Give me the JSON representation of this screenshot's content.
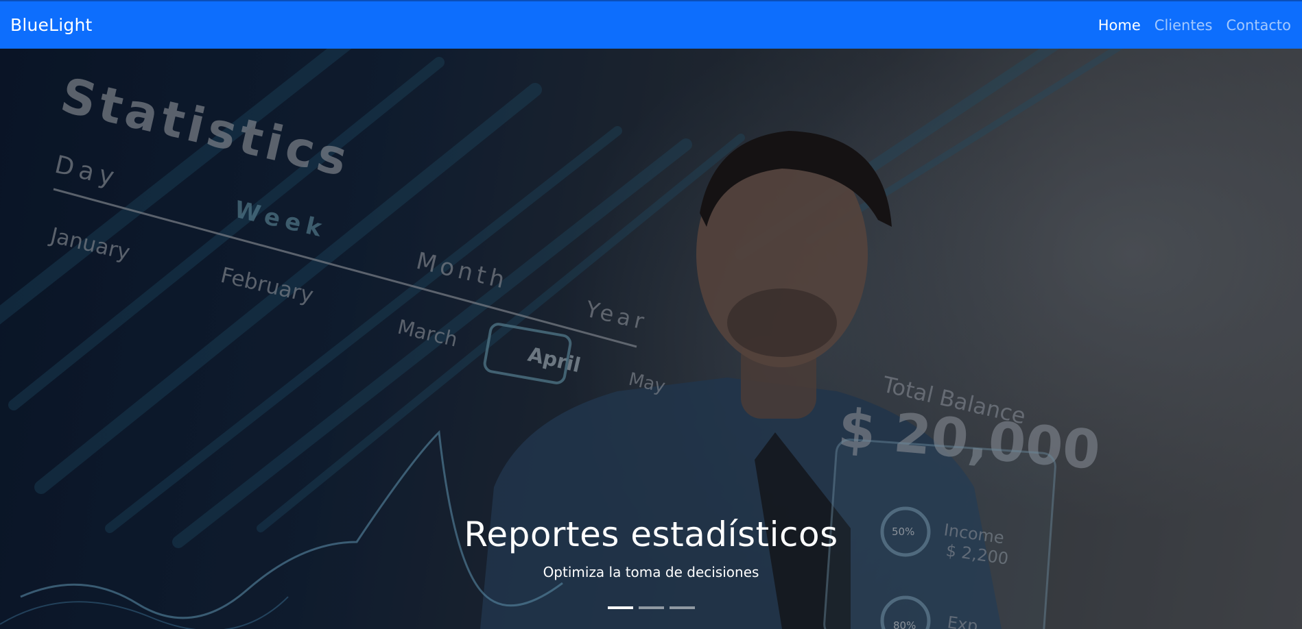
{
  "navbar": {
    "brand": "BlueLight",
    "links": [
      {
        "label": "Home",
        "active": true
      },
      {
        "label": "Clientes",
        "active": false
      },
      {
        "label": "Contacto",
        "active": false
      }
    ],
    "color": "#0d6efd"
  },
  "hero": {
    "background_text": {
      "heading": "Statistics",
      "scale": [
        "Day",
        "Week",
        "Month",
        "Year"
      ],
      "months": [
        "January",
        "February",
        "March",
        "April",
        "May"
      ],
      "balance_label": "Total Balance",
      "balance_value": "$ 20,000",
      "gauge_1": "50%",
      "income_label": "Income",
      "income_value": "$ 2,200",
      "gauge_2": "80%",
      "expense_label": "Exp"
    },
    "caption": {
      "title": "Reportes estadísticos",
      "subtitle": "Optimiza la toma de decisiones"
    },
    "indicators": {
      "count": 3,
      "active_index": 0
    }
  }
}
